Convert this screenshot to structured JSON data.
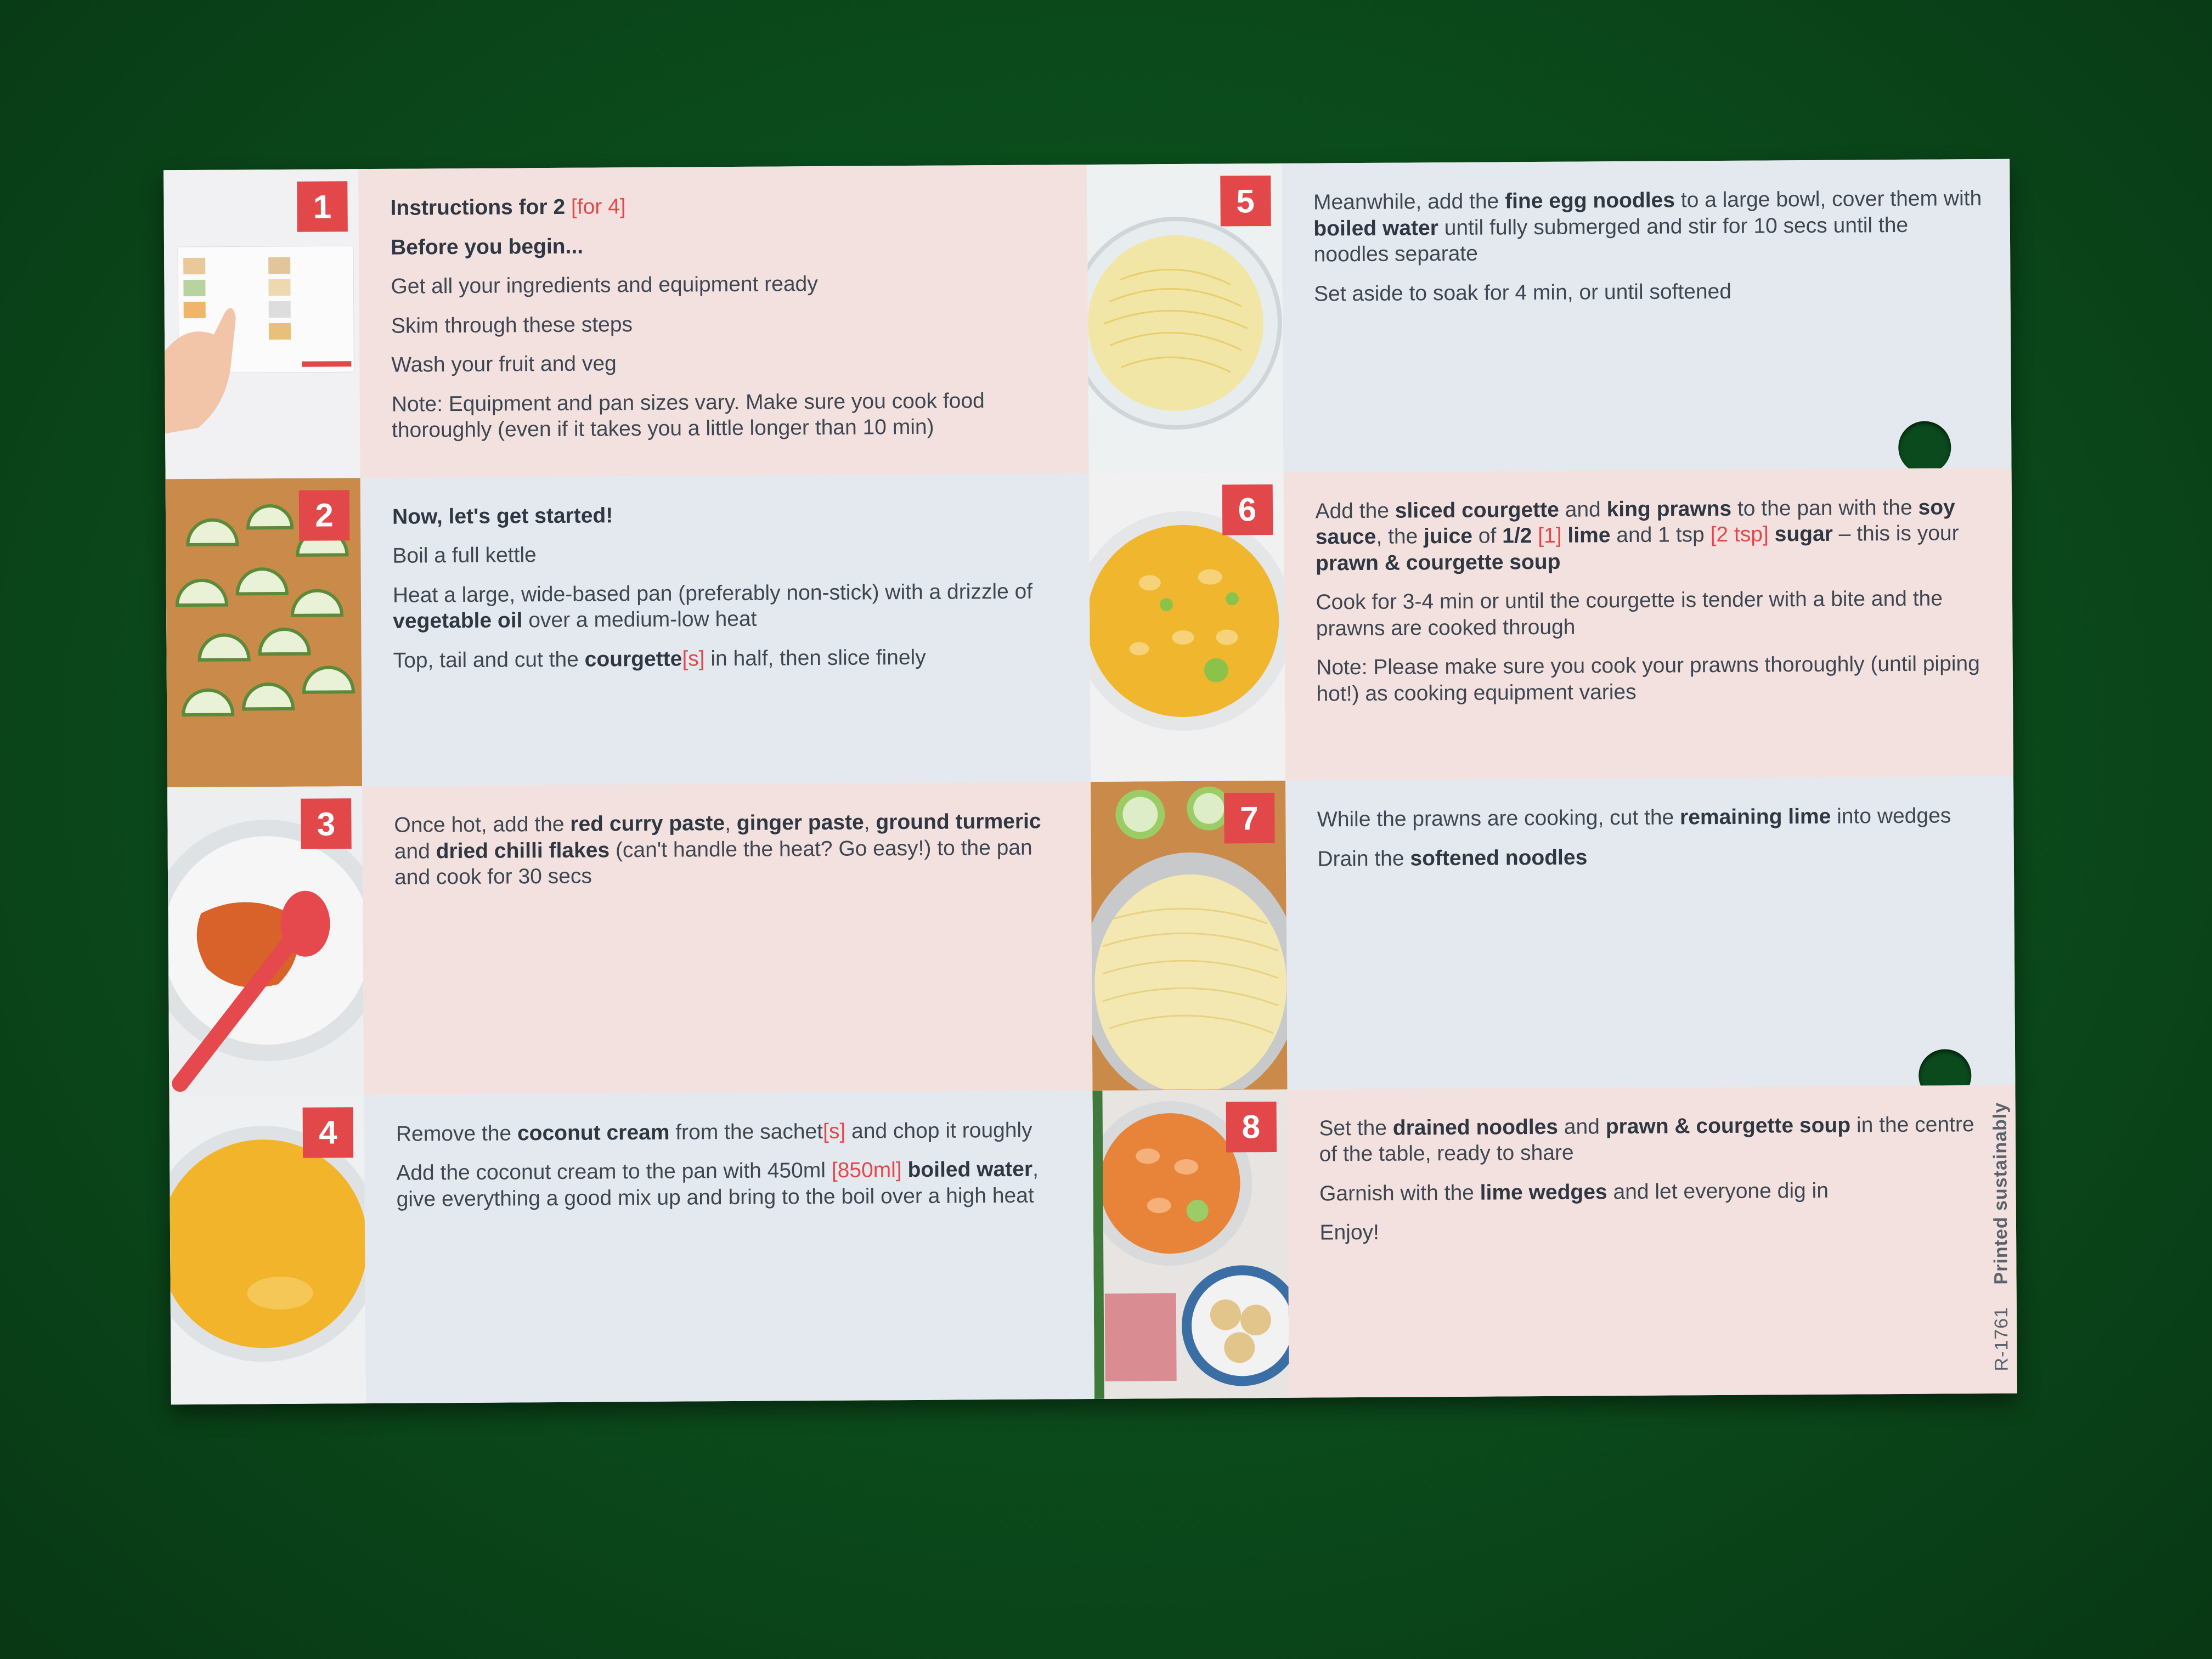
{
  "steps": [
    {
      "number": "1",
      "lines": {
        "intro_prefix": "Instructions for 2 ",
        "intro_alt": "[for 4]",
        "before": "Before you begin...",
        "l1": "Get all your ingredients and equipment ready",
        "l2": "Skim through these steps",
        "l3": "Wash your fruit and veg",
        "l4": "Note: Equipment and pan sizes vary. Make sure you cook food thoroughly (even if it takes you a little longer than 10 min)"
      }
    },
    {
      "number": "2",
      "lines": {
        "l1": "Now, let's get started!",
        "l2": "Boil a full kettle",
        "l3a": "Heat a large, wide-based pan (preferably non-stick) with a drizzle of ",
        "l3b": "vegetable oil",
        "l3c": " over a medium-low heat",
        "l4a": "Top, tail and cut the ",
        "l4b": "courgette",
        "l4c": "[s]",
        "l4d": " in half, then slice finely"
      }
    },
    {
      "number": "3",
      "lines": {
        "a": "Once hot, add the ",
        "b": "red curry paste",
        "c": ", ",
        "d": "ginger paste",
        "e": ", ",
        "f": "ground turmeric",
        "g": " and ",
        "h": "dried chilli flakes",
        "i": " (can't handle the heat? Go easy!) to the pan and cook for 30 secs"
      }
    },
    {
      "number": "4",
      "lines": {
        "a": "Remove the ",
        "b": "coconut cream",
        "c": " from the sachet",
        "d": "[s]",
        "e": " and chop it roughly",
        "f": "Add the coconut cream to the pan with 450ml ",
        "g": "[850ml]",
        "h": " boiled water",
        "i": ", give everything a good mix up and bring to the boil over a high heat"
      }
    },
    {
      "number": "5",
      "lines": {
        "a": "Meanwhile, add the ",
        "b": "fine egg noodles",
        "c": " to a large bowl, cover them with ",
        "d": "boiled water",
        "e": " until fully submerged and stir for 10 secs until the noodles separate",
        "f": "Set aside to soak for 4 min, or until softened"
      }
    },
    {
      "number": "6",
      "lines": {
        "a": "Add the ",
        "b": "sliced courgette",
        "c": " and ",
        "d": "king prawns",
        "e": " to the pan with the ",
        "f": "soy sauce",
        "g": ", the ",
        "h": "juice",
        "i": " of ",
        "j": "1/2",
        "k": " [1]",
        "l": " lime",
        "m": " and 1 tsp ",
        "n": "[2 tsp]",
        "o": " sugar",
        "p": " – this is your ",
        "q": "prawn & courgette soup",
        "r": "Cook for 3-4 min or until the courgette is tender with a bite and the prawns are cooked through",
        "s": "Note: Please make sure you cook your prawns thoroughly (until piping hot!) as cooking equipment varies"
      }
    },
    {
      "number": "7",
      "lines": {
        "a": "While the prawns are cooking, cut the ",
        "b": "remaining lime",
        "c": " into wedges",
        "d": "Drain the ",
        "e": "softened noodles"
      }
    },
    {
      "number": "8",
      "lines": {
        "a": "Set the ",
        "b": "drained noodles",
        "c": " and ",
        "d": "prawn & courgette soup",
        "e": " in the centre of the table, ready to share",
        "f": "Garnish with the ",
        "g": "lime wedges",
        "h": " and let everyone dig in",
        "i": "Enjoy!"
      }
    }
  ],
  "footer": {
    "code": "R-1761",
    "printed": "Printed sustainably"
  }
}
